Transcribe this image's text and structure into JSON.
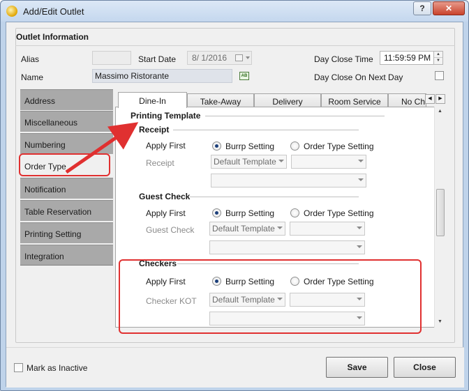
{
  "window": {
    "title": "Add/Edit Outlet",
    "help_label": "?",
    "close_label": "✕"
  },
  "group": {
    "title": "Outlet Information"
  },
  "fields": {
    "alias_label": "Alias",
    "alias_value": "",
    "start_date_label": "Start Date",
    "start_date_value": "8/  1/2016",
    "day_close_time_label": "Day Close Time",
    "day_close_time_value": "11:59:59 PM",
    "name_label": "Name",
    "name_value": "Massimo Ristorante",
    "day_close_next_label": "Day Close On Next Day"
  },
  "sidenav": {
    "items": [
      {
        "label": "Address"
      },
      {
        "label": "Miscellaneous"
      },
      {
        "label": "Numbering"
      },
      {
        "label": "Order Type"
      },
      {
        "label": "Notification"
      },
      {
        "label": "Table Reservation"
      },
      {
        "label": "Printing Setting"
      },
      {
        "label": "Integration"
      }
    ],
    "active": "Order Type"
  },
  "tabs": [
    {
      "label": "Dine-In"
    },
    {
      "label": "Take-Away"
    },
    {
      "label": "Delivery"
    },
    {
      "label": "Room Service"
    },
    {
      "label": "No Cha"
    }
  ],
  "panel": {
    "printing_template": "Printing Template",
    "apply_first_label": "Apply First",
    "burrp_setting": "Burrp Setting",
    "order_type_setting": "Order Type Setting",
    "default_template": "Default Template",
    "sections": [
      {
        "title": "Receipt",
        "row_label": "Receipt"
      },
      {
        "title": "Guest Check",
        "row_label": "Guest Check"
      },
      {
        "title": "Checkers",
        "row_label": "Checker KOT"
      }
    ]
  },
  "footer": {
    "mark_inactive": "Mark as Inactive",
    "save": "Save",
    "close": "Close"
  },
  "colors": {
    "annotation": "#e03030",
    "window_frame": "#bfd3ea",
    "nav_bg": "#a9a9a9"
  },
  "icons": [
    "app-icon",
    "help-icon",
    "close-icon",
    "calendar-icon",
    "spin-up-icon",
    "spin-down-icon",
    "text-format-icon",
    "scroll-left-icon",
    "scroll-right-icon",
    "scroll-up-icon",
    "scroll-down-icon",
    "dropdown-arrow-icon"
  ]
}
